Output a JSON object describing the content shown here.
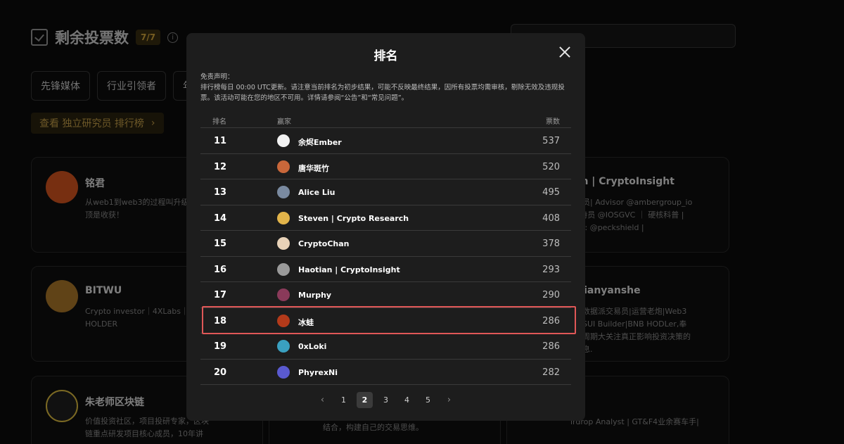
{
  "page": {
    "votes_title": "剩余投票数",
    "votes_badge": "7/7",
    "info_icon": "i",
    "filters": [
      "先锋媒体",
      "行业引领者",
      "年"
    ],
    "research_link": "查看 独立研究员 排行榜",
    "research_link_arrow": "›"
  },
  "cards": [
    {
      "name": "铭君",
      "bio": "从web1到web3的过程叫升级，逃顶是收获！"
    },
    {
      "name": "an | CryptoInsight",
      "bio": "究员| Advisor @ambergroup_io | 特员 @IOSGVC ｜ 硬核科普 | sly: @peckshield |"
    },
    {
      "name": "BITWU",
      "bio": "Crypto investor｜4XLabs｜BTC HOLDER"
    },
    {
      "name": "clianyanshe",
      "bio": "的数据派交易员|运营老炮|Web3创SUI Builder|BNB HODLer,奉行周期大关注真正影响投资决策的信息."
    },
    {
      "name": "朱老师区块链",
      "bio": "价值投资社区，项目投研专家，区块链重点研发项目核心成员，10年讲"
    },
    {
      "name": "",
      "bio": "结合，构建自己的交易思维。"
    },
    {
      "name": "",
      "bio": "irdrop Analyst | GT&F4业余赛车手|"
    }
  ],
  "modal": {
    "title": "排名",
    "disclaimer_title": "免责声明：",
    "disclaimer_body": "排行榜每日 00:00 UTC更新。请注意当前排名为初步结果，可能不反映最终结果，因所有投票均需审核，剔除无效及违规投票。该活动可能在您的地区不可用。详情请参阅“公告”和“常见问题”。",
    "columns": {
      "rank": "排名",
      "player": "赢家",
      "votes": "票数"
    },
    "rows": [
      {
        "rank": "11",
        "name": "余烬Ember",
        "votes": "537",
        "avatar_color": "#f2f2f2"
      },
      {
        "rank": "12",
        "name": "唐华斑竹",
        "votes": "520",
        "avatar_color": "#c9673a"
      },
      {
        "rank": "13",
        "name": "Alice Liu",
        "votes": "495",
        "avatar_color": "#7a8aa0"
      },
      {
        "rank": "14",
        "name": "Steven | Crypto Research",
        "votes": "408",
        "avatar_color": "#e2b44a"
      },
      {
        "rank": "15",
        "name": "CryptoChan",
        "votes": "378",
        "avatar_color": "#e8d2b8"
      },
      {
        "rank": "16",
        "name": "Haotian | CryptoInsight",
        "votes": "293",
        "avatar_color": "#9a9a9a"
      },
      {
        "rank": "17",
        "name": "Murphy",
        "votes": "290",
        "avatar_color": "#8a3a5a"
      },
      {
        "rank": "18",
        "name": "冰蛙",
        "votes": "286",
        "avatar_color": "#b33a1a"
      },
      {
        "rank": "19",
        "name": "0xLoki",
        "votes": "286",
        "avatar_color": "#3aa0c0"
      },
      {
        "rank": "20",
        "name": "PhyrexNi",
        "votes": "282",
        "avatar_color": "#5a5ad0"
      }
    ],
    "highlighted_rank": "18",
    "pagination": {
      "prev": "‹",
      "pages": [
        "1",
        "2",
        "3",
        "4",
        "5"
      ],
      "current": "2",
      "next": "›"
    }
  },
  "colors": {
    "accent_gold": "#d8a93c",
    "highlight_red": "#e05757",
    "modal_bg": "#1d1d1d"
  }
}
